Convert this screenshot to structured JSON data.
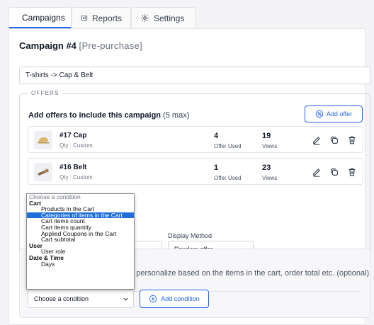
{
  "tabs": [
    {
      "label": "Campaigns",
      "icon": "layers-icon",
      "active": true
    },
    {
      "label": "Reports",
      "icon": "reports-icon",
      "active": false
    },
    {
      "label": "Settings",
      "icon": "gear-icon",
      "active": false
    }
  ],
  "campaign": {
    "title": "Campaign #4",
    "tag": "[Pre-purchase]",
    "name_value": "T-shirts -> Cap & Belt"
  },
  "offers": {
    "legend": "OFFERS",
    "heading": "Add offers to include this campaign",
    "heading_note": "(5 max)",
    "add_button": "Add offer",
    "items": [
      {
        "name": "#17 Cap",
        "qty": "Qty : Custom",
        "offer_used": "4",
        "offer_used_label": "Offer Used",
        "views": "19",
        "views_label": "Views"
      },
      {
        "name": "#16 Belt",
        "qty": "Qty : Custom",
        "offer_used": "1",
        "offer_used_label": "Offer Used",
        "views": "23",
        "views_label": "Views"
      }
    ],
    "display_method_label": "Display Method",
    "display_method_value": "Random offer"
  },
  "conditions": {
    "description": "to personalize based on the items in the cart, order total etc. (optional)",
    "select_value": "Choose a condition",
    "add_button": "Add condition"
  },
  "dropdown": {
    "rows": [
      {
        "text": "Choose a condition",
        "kind": "placeholder"
      },
      {
        "text": "Cart",
        "kind": "group"
      },
      {
        "text": "Products in the Cart",
        "kind": "opt"
      },
      {
        "text": "Categories of items in the Cart",
        "kind": "opt",
        "selected": true
      },
      {
        "text": "Cart items count",
        "kind": "opt"
      },
      {
        "text": "Cart items quantity",
        "kind": "opt"
      },
      {
        "text": "Applied Coupons in the Cart",
        "kind": "opt"
      },
      {
        "text": "Cart subtotal",
        "kind": "opt"
      },
      {
        "text": "User",
        "kind": "group"
      },
      {
        "text": "User role",
        "kind": "opt"
      },
      {
        "text": "Date & Time",
        "kind": "group"
      },
      {
        "text": "Days",
        "kind": "opt"
      }
    ]
  },
  "colors": {
    "accent": "#2563eb",
    "selected": "#1e6fd9"
  }
}
